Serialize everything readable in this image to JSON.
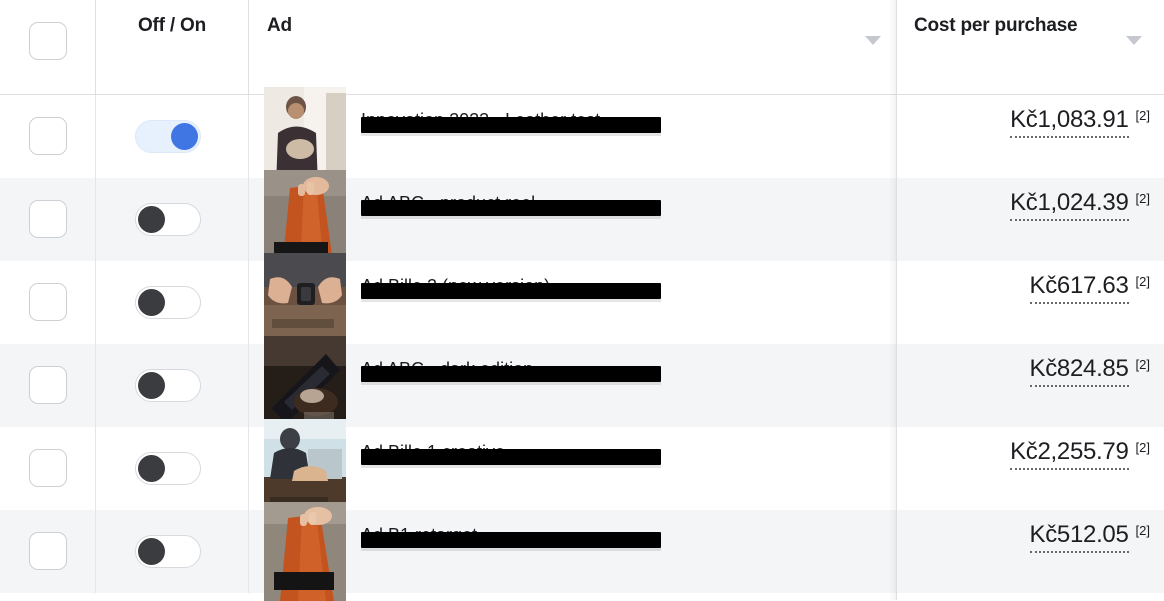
{
  "table": {
    "columns": [
      {
        "key": "select",
        "label": "",
        "sortable": false
      },
      {
        "key": "onoff",
        "label": "Off / On",
        "sortable": false
      },
      {
        "key": "ad",
        "label": "Ad",
        "sortable": true,
        "sort_icon": "chevron-down-icon"
      },
      {
        "key": "cost",
        "label": "Cost per purchase",
        "sortable": true,
        "sort_icon": "chevron-down-icon"
      }
    ],
    "rows": [
      {
        "selected": false,
        "toggle_state": "on",
        "toggle_label": "On",
        "ad_name": "Innovation 2023 - Leather test",
        "ad_name_redacted": true,
        "thumbnail": "man-holding-product-photo",
        "cost_per_purchase": "Kč1,083.91",
        "footnote": "[2]"
      },
      {
        "selected": false,
        "toggle_state": "off",
        "toggle_label": "Off",
        "ad_name": "Ad ABC - product reel",
        "ad_name_redacted": true,
        "thumbnail": "hand-on-orange-leather-photo",
        "cost_per_purchase": "Kč1,024.39",
        "footnote": "[2]"
      },
      {
        "selected": false,
        "toggle_state": "off",
        "toggle_label": "Off",
        "ad_name": "Ad Bille 2 (new version)",
        "ad_name_redacted": true,
        "thumbnail": "hands-fastening-belt-photo",
        "cost_per_purchase": "Kč617.63",
        "footnote": "[2]"
      },
      {
        "selected": false,
        "toggle_state": "off",
        "toggle_label": "Off",
        "ad_name": "Ad ABC - dark edition",
        "ad_name_redacted": true,
        "thumbnail": "dark-leather-wallet-photo",
        "cost_per_purchase": "Kč824.85",
        "footnote": "[2]"
      },
      {
        "selected": false,
        "toggle_state": "off",
        "toggle_label": "Off",
        "ad_name": "Ad Bille 1 creative",
        "ad_name_redacted": true,
        "thumbnail": "workshop-craftsman-photo",
        "cost_per_purchase": "Kč2,255.79",
        "footnote": "[2]"
      },
      {
        "selected": false,
        "toggle_state": "off",
        "toggle_label": "Off",
        "ad_name": "Ad B1 retarget",
        "ad_name_redacted": true,
        "thumbnail": "hand-orange-leather-caption-photo",
        "cost_per_purchase": "Kč512.05",
        "footnote": "[2]"
      }
    ]
  },
  "colors": {
    "toggle_on_track": "#e7f0fd",
    "toggle_on_knob": "#3f76e4",
    "toggle_off_knob": "#3a3c3f",
    "row_alt_background": "#f4f5f7",
    "border": "#dddfe2",
    "text": "#1c1e21"
  }
}
